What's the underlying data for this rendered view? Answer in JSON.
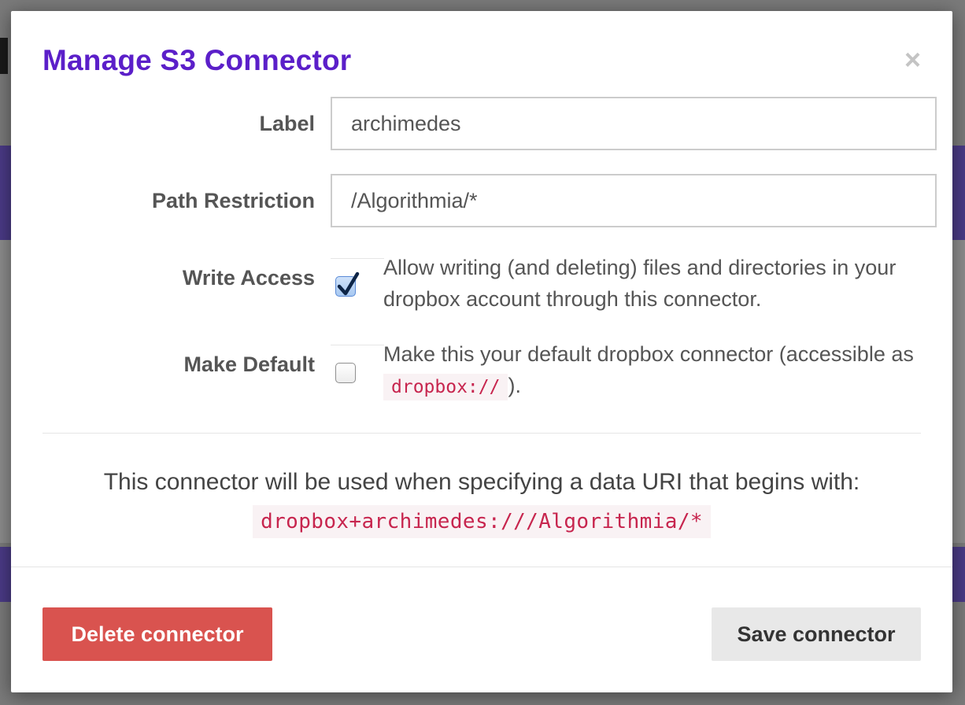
{
  "modal": {
    "title": "Manage S3 Connector",
    "close_label": "×"
  },
  "form": {
    "label": {
      "label": "Label",
      "value": "archimedes"
    },
    "path_restriction": {
      "label": "Path Restriction",
      "value": "/Algorithmia/*"
    },
    "write_access": {
      "label": "Write Access",
      "checked": true,
      "help": "Allow writing (and deleting) files and directories in your dropbox account through this connector."
    },
    "make_default": {
      "label": "Make Default",
      "checked": false,
      "help_prefix": "Make this your default dropbox connector (accessible as",
      "help_code": "dropbox://",
      "help_suffix": ")."
    }
  },
  "info": {
    "text": "This connector will be used when specifying a data URI that begins with:",
    "uri": "dropbox+archimedes:///Algorithmia/*"
  },
  "footer": {
    "delete_label": "Delete connector",
    "save_label": "Save connector"
  },
  "colors": {
    "title": "#5b1fc9",
    "danger": "#d9534f",
    "code": "#c7254e"
  }
}
